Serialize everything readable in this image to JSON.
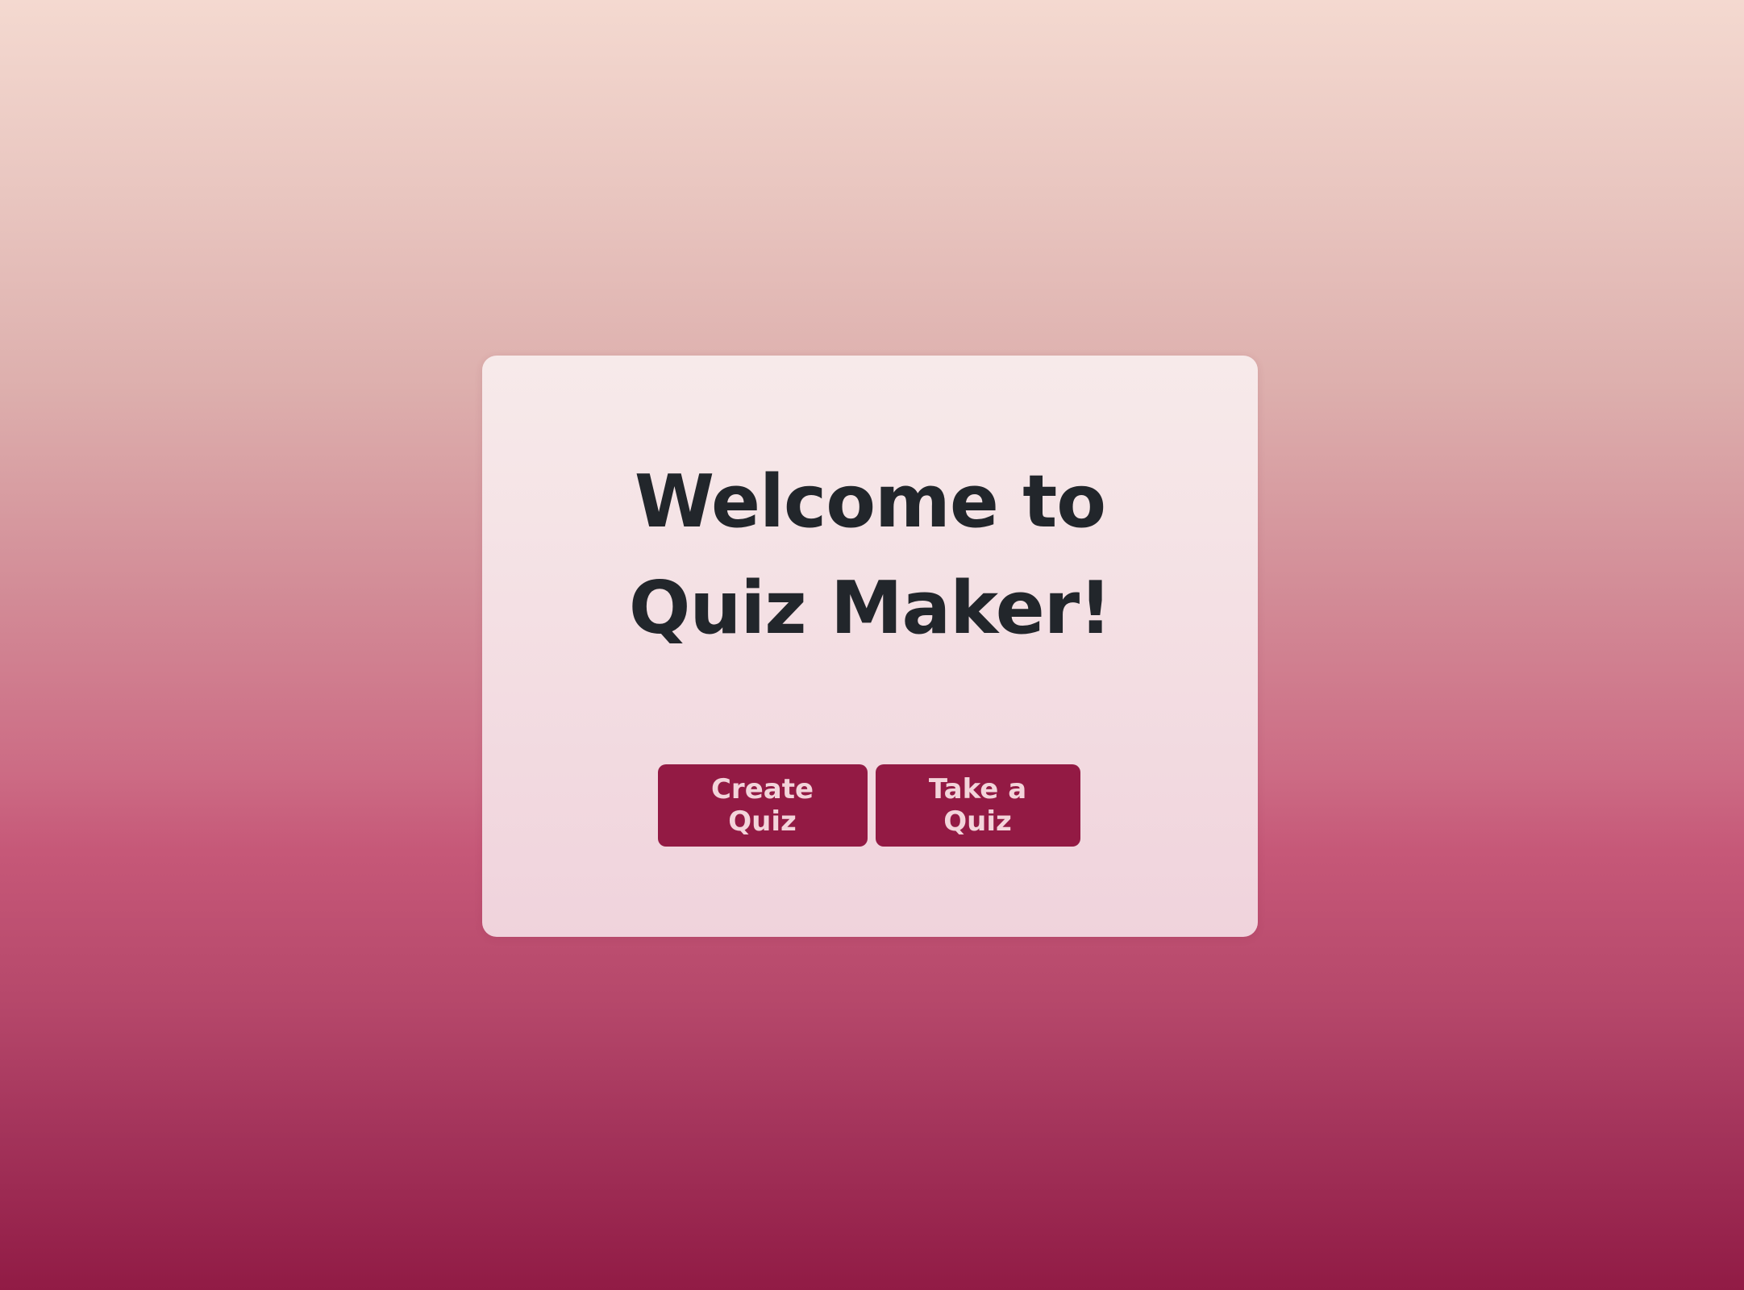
{
  "welcome": {
    "title": "Welcome to Quiz Maker!"
  },
  "actions": {
    "create_label": "Create Quiz",
    "take_label": "Take a Quiz"
  },
  "colors": {
    "button_background": "#931a44",
    "button_text": "#f3d4da",
    "title_text": "#22262b",
    "gradient_top": "#f4d9d0",
    "gradient_bottom": "#911b45"
  }
}
